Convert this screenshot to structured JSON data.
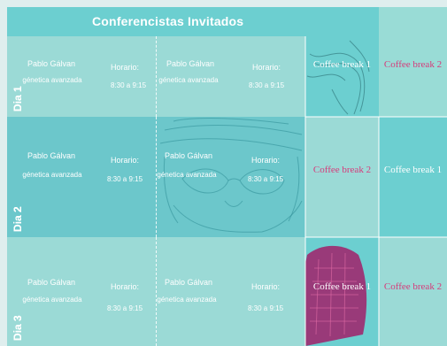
{
  "header": {
    "title": "Conferencistas Invitados"
  },
  "days": [
    {
      "label": "Dia 1",
      "sessions": [
        {
          "speaker": "Pablo Gálvan",
          "topic": "génetica avanzada",
          "time_label": "Horario:",
          "time": "8:30 a 9:15"
        },
        {
          "speaker": "Pablo Gálvan",
          "topic": "génetica avanzada",
          "time_label": "Horario:",
          "time": "8:30 a 9:15"
        }
      ],
      "breaks": [
        {
          "text": "Coffee break 1",
          "color": "#ffffff"
        },
        {
          "text": "Coffee break 2",
          "color": "#d63b7a"
        }
      ]
    },
    {
      "label": "Dia 2",
      "sessions": [
        {
          "speaker": "Pablo Gálvan",
          "topic": "génetica avanzada",
          "time_label": "Horario:",
          "time": "8:30 a 9:15"
        },
        {
          "speaker": "Pablo Gálvan",
          "topic": "génetica avanzada",
          "time_label": "Horario:",
          "time": "8:30 a 9:15"
        }
      ],
      "breaks": [
        {
          "text": "Coffee break 2",
          "color": "#d63b7a"
        },
        {
          "text": "Coffee break 1",
          "color": "#ffffff"
        }
      ]
    },
    {
      "label": "Dia 3",
      "sessions": [
        {
          "speaker": "Pablo Gálvan",
          "topic": "génetica avanzada",
          "time_label": "Horario:",
          "time": "8:30 a 9:15"
        },
        {
          "speaker": "Pablo Gálvan",
          "topic": "génetica avanzada",
          "time_label": "Horario:",
          "time": "8:30 a 9:15"
        }
      ],
      "breaks": [
        {
          "text": "Coffee break 1",
          "color": "#ffffff"
        },
        {
          "text": "Coffee break 2",
          "color": "#d63b7a"
        }
      ]
    }
  ],
  "colors": {
    "header": "#6ccfd0",
    "light": "#9bdad6",
    "dark": "#6cc7cb",
    "pink": "#d63b7a",
    "magenta_photo": "#a1206a"
  }
}
